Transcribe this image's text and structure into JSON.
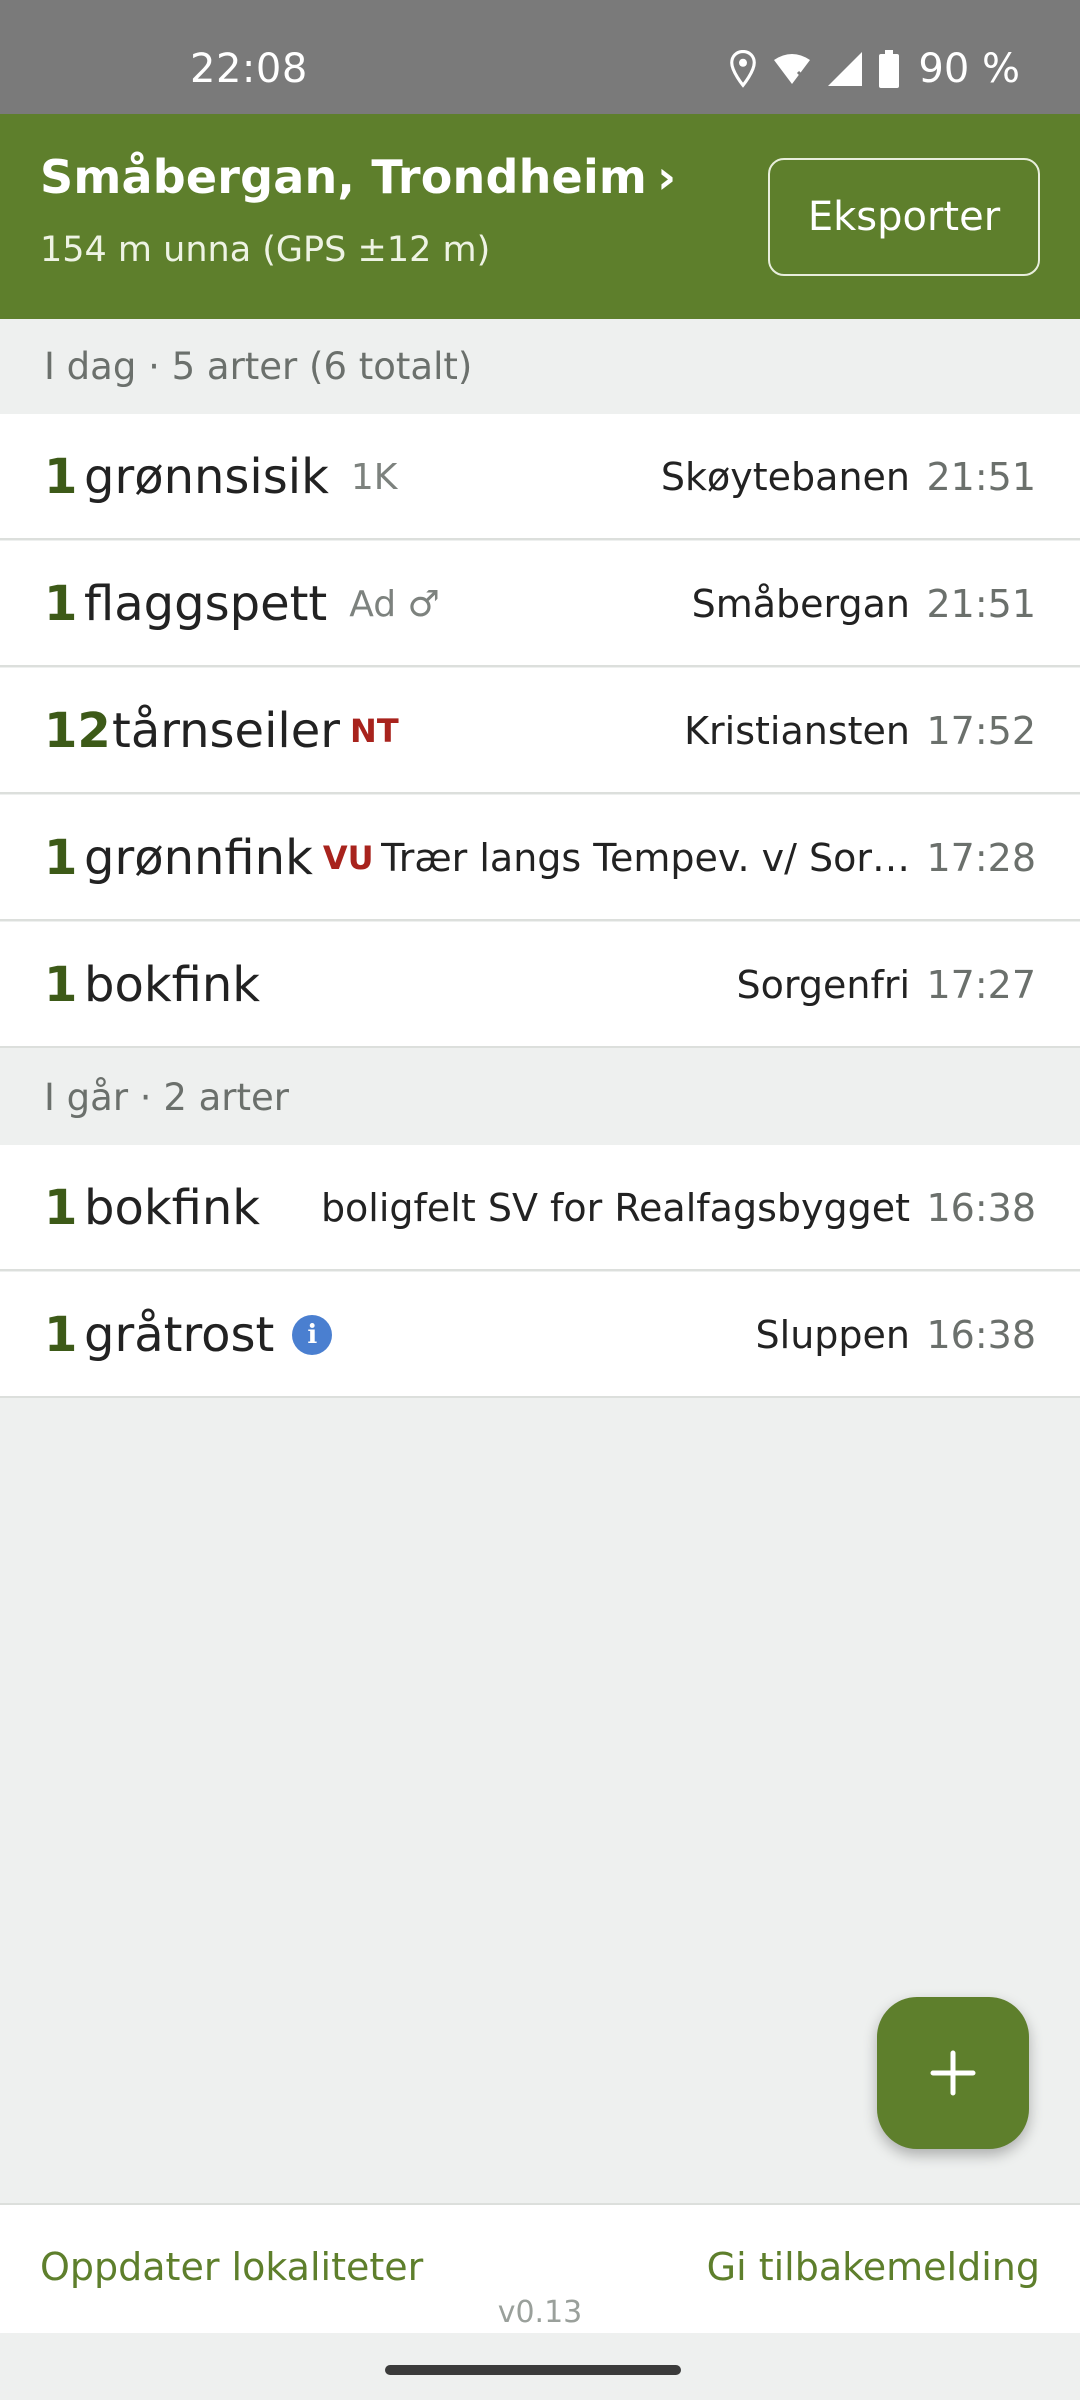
{
  "status_bar": {
    "time": "22:08",
    "battery": "90 %",
    "icons": [
      "location-icon",
      "wifi-icon",
      "signal-icon",
      "battery-icon"
    ]
  },
  "header": {
    "location": "Småbergan, Trondheim",
    "chevron": "›",
    "distance": "154 m unna (GPS ±12 m)",
    "export_label": "Eksporter"
  },
  "sections": [
    {
      "title": "I dag · 5 arter (6 totalt)"
    },
    {
      "title": "I går · 2 arter"
    }
  ],
  "today": [
    {
      "count": "1",
      "species": "grønnsisik",
      "tag": "1K",
      "redlist": "",
      "place": "Skøytebanen",
      "time": "21:51"
    },
    {
      "count": "1",
      "species": "flaggspett",
      "tag": "Ad ♂",
      "redlist": "",
      "place": "Småbergan",
      "time": "21:51"
    },
    {
      "count": "12",
      "species": "tårnseiler",
      "tag": "",
      "redlist": "NT",
      "place": "Kristiansten",
      "time": "17:52"
    },
    {
      "count": "1",
      "species": "grønnfink",
      "tag": "",
      "redlist": "VU",
      "place": "Trær langs Tempev. v/ Sor…",
      "time": "17:28"
    },
    {
      "count": "1",
      "species": "bokfink",
      "tag": "",
      "redlist": "",
      "place": "Sorgenfri",
      "time": "17:27"
    }
  ],
  "yesterday": [
    {
      "count": "1",
      "species": "bokfink",
      "tag": "",
      "redlist": "",
      "place": "boligfelt SV for Realfagsbygget",
      "time": "16:38"
    },
    {
      "count": "1",
      "species": "gråtrost",
      "tag": "",
      "redlist": "",
      "info": "i",
      "place": "Sluppen",
      "time": "16:38"
    }
  ],
  "colors": {
    "brand_green": "#5e7f2c",
    "count_green": "#3d5a18",
    "redlist_red": "#a8231d",
    "info_blue": "#4a7fd0"
  },
  "fab": {
    "icon": "plus-icon"
  },
  "bottom_bar": {
    "left_link": "Oppdater lokaliteter",
    "right_link": "Gi tilbakemelding",
    "version": "v0.13"
  }
}
